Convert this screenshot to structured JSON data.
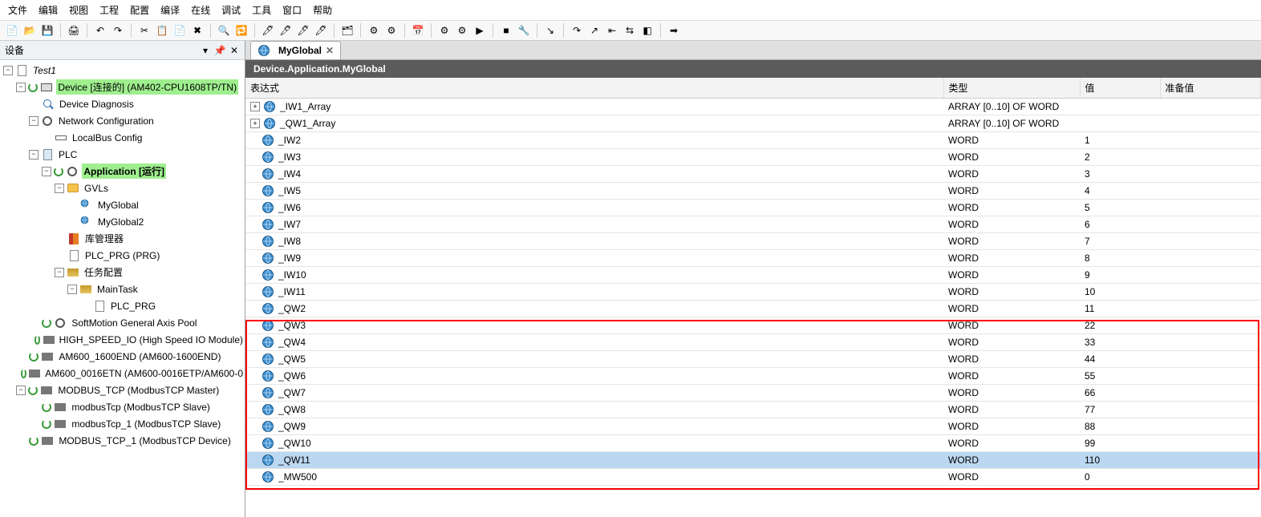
{
  "menu": [
    "文件",
    "编辑",
    "视图",
    "工程",
    "配置",
    "编译",
    "在线",
    "调试",
    "工具",
    "窗口",
    "帮助"
  ],
  "left": {
    "title": "设备",
    "project": "Test1",
    "nodes": [
      {
        "ind": 0,
        "exp": "-",
        "icon": "file",
        "label": "Test1",
        "italic": true
      },
      {
        "ind": 1,
        "exp": "-",
        "icon": "dev",
        "refresh": true,
        "label": "Device [连接的] (AM402-CPU1608TP/TN)",
        "hl": true
      },
      {
        "ind": 2,
        "exp": "",
        "icon": "search",
        "label": "Device Diagnosis"
      },
      {
        "ind": 2,
        "exp": "-",
        "icon": "tools",
        "label": "Network Configuration"
      },
      {
        "ind": 3,
        "exp": "",
        "icon": "iface",
        "label": "LocalBus Config"
      },
      {
        "ind": 2,
        "exp": "-",
        "icon": "plc",
        "label": "PLC"
      },
      {
        "ind": 3,
        "exp": "-",
        "icon": "gear",
        "refresh": true,
        "label": "Application [运行]",
        "hl": true,
        "bold": true
      },
      {
        "ind": 4,
        "exp": "-",
        "icon": "folder",
        "label": "GVLs"
      },
      {
        "ind": 5,
        "exp": "",
        "icon": "globe",
        "label": "MyGlobal"
      },
      {
        "ind": 5,
        "exp": "",
        "icon": "globe",
        "label": "MyGlobal2"
      },
      {
        "ind": 4,
        "exp": "",
        "icon": "lib",
        "label": "库管理器"
      },
      {
        "ind": 4,
        "exp": "",
        "icon": "file",
        "label": "PLC_PRG (PRG)"
      },
      {
        "ind": 4,
        "exp": "-",
        "icon": "tasks",
        "label": "任务配置"
      },
      {
        "ind": 5,
        "exp": "-",
        "icon": "task",
        "label": "MainTask"
      },
      {
        "ind": 6,
        "exp": "",
        "icon": "file",
        "label": "PLC_PRG"
      },
      {
        "ind": 2,
        "exp": "",
        "icon": "axis",
        "refresh": true,
        "label": "SoftMotion General Axis Pool"
      },
      {
        "ind": 2,
        "exp": "",
        "icon": "mod",
        "refresh": true,
        "label": "HIGH_SPEED_IO (High Speed IO Module)"
      },
      {
        "ind": 1,
        "exp": "",
        "icon": "mod",
        "refresh": true,
        "label": "AM600_1600END (AM600-1600END)"
      },
      {
        "ind": 1,
        "exp": "",
        "icon": "mod",
        "refresh": true,
        "label": "AM600_0016ETN (AM600-0016ETP/AM600-0"
      },
      {
        "ind": 1,
        "exp": "-",
        "icon": "mod",
        "refresh": true,
        "label": "MODBUS_TCP (ModbusTCP Master)"
      },
      {
        "ind": 2,
        "exp": "",
        "icon": "mod",
        "refresh": true,
        "label": "modbusTcp (ModbusTCP Slave)"
      },
      {
        "ind": 2,
        "exp": "",
        "icon": "mod",
        "refresh": true,
        "label": "modbusTcp_1 (ModbusTCP Slave)"
      },
      {
        "ind": 1,
        "exp": "",
        "icon": "mod",
        "refresh": true,
        "label": "MODBUS_TCP_1 (ModbusTCP Device)"
      }
    ]
  },
  "tab": {
    "label": "MyGlobal"
  },
  "path": "Device.Application.MyGlobal",
  "columns": {
    "expr": "表达式",
    "type": "类型",
    "value": "值",
    "prep": "准备值"
  },
  "rows": [
    {
      "exp": "+",
      "name": "_IW1_Array",
      "type": "ARRAY [0..10] OF WORD",
      "val": "",
      "box": false
    },
    {
      "exp": "+",
      "name": "_QW1_Array",
      "type": "ARRAY [0..10] OF WORD",
      "val": "",
      "box": false
    },
    {
      "exp": "",
      "name": "_IW2",
      "type": "WORD",
      "val": "1",
      "box": false
    },
    {
      "exp": "",
      "name": "_IW3",
      "type": "WORD",
      "val": "2",
      "box": false
    },
    {
      "exp": "",
      "name": "_IW4",
      "type": "WORD",
      "val": "3",
      "box": false
    },
    {
      "exp": "",
      "name": "_IW5",
      "type": "WORD",
      "val": "4",
      "box": false
    },
    {
      "exp": "",
      "name": "_IW6",
      "type": "WORD",
      "val": "5",
      "box": false
    },
    {
      "exp": "",
      "name": "_IW7",
      "type": "WORD",
      "val": "6",
      "box": false
    },
    {
      "exp": "",
      "name": "_IW8",
      "type": "WORD",
      "val": "7",
      "box": false
    },
    {
      "exp": "",
      "name": "_IW9",
      "type": "WORD",
      "val": "8",
      "box": false
    },
    {
      "exp": "",
      "name": "_IW10",
      "type": "WORD",
      "val": "9",
      "box": false
    },
    {
      "exp": "",
      "name": "_IW11",
      "type": "WORD",
      "val": "10",
      "box": false
    },
    {
      "exp": "",
      "name": "_QW2",
      "type": "WORD",
      "val": "11",
      "box": true
    },
    {
      "exp": "",
      "name": "_QW3",
      "type": "WORD",
      "val": "22",
      "box": true
    },
    {
      "exp": "",
      "name": "_QW4",
      "type": "WORD",
      "val": "33",
      "box": true
    },
    {
      "exp": "",
      "name": "_QW5",
      "type": "WORD",
      "val": "44",
      "box": true
    },
    {
      "exp": "",
      "name": "_QW6",
      "type": "WORD",
      "val": "55",
      "box": true
    },
    {
      "exp": "",
      "name": "_QW7",
      "type": "WORD",
      "val": "66",
      "box": true
    },
    {
      "exp": "",
      "name": "_QW8",
      "type": "WORD",
      "val": "77",
      "box": true
    },
    {
      "exp": "",
      "name": "_QW9",
      "type": "WORD",
      "val": "88",
      "box": true
    },
    {
      "exp": "",
      "name": "_QW10",
      "type": "WORD",
      "val": "99",
      "box": true
    },
    {
      "exp": "",
      "name": "_QW11",
      "type": "WORD",
      "val": "110",
      "box": true,
      "sel": true
    },
    {
      "exp": "",
      "name": "_MW500",
      "type": "WORD",
      "val": "0",
      "box": false
    }
  ],
  "toolbar_icons": [
    "new",
    "open",
    "save",
    "print",
    "undo",
    "redo",
    "cut",
    "copy",
    "paste",
    "delete",
    "find",
    "replace",
    "brush1",
    "brush2",
    "brush3",
    "brush4",
    "props",
    "cfg1",
    "cfg2",
    "cal",
    "gear1",
    "gear2",
    "play",
    "stop",
    "wrench",
    "step-into",
    "step-over",
    "step-out",
    "step-return",
    "toggle",
    "misc",
    "right"
  ]
}
